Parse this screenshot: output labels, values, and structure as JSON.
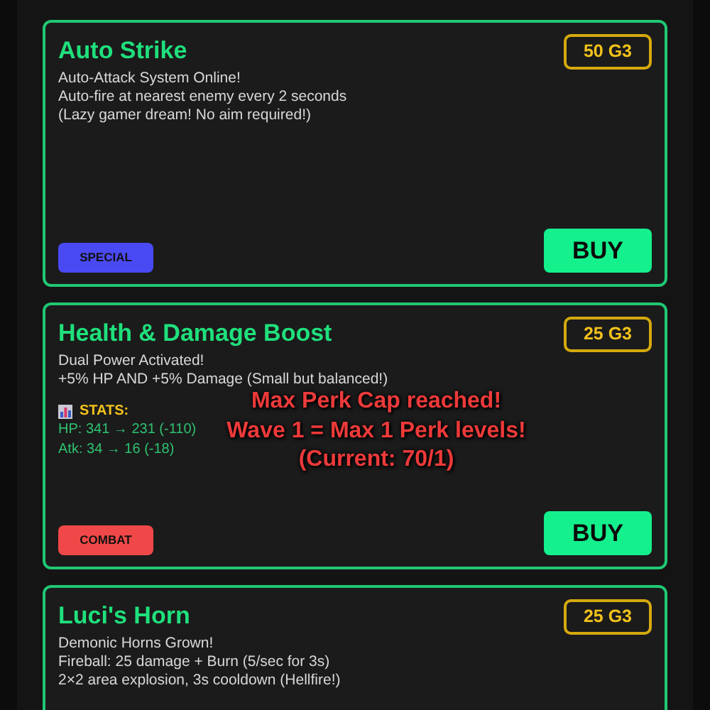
{
  "cards": [
    {
      "title": "Auto Strike",
      "price": "50 G3",
      "description": [
        "Auto-Attack System Online!",
        "Auto-fire at nearest enemy every 2 seconds",
        "(Lazy gamer dream! No aim required!)"
      ],
      "tag": {
        "label": "SPECIAL",
        "color": "#4a4af5"
      },
      "button": "BUY"
    },
    {
      "title": "Health & Damage Boost",
      "price": "25 G3",
      "description": [
        "Dual Power Activated!",
        "+5% HP AND +5% Damage (Small but balanced!)"
      ],
      "stats": {
        "label": "STATS:",
        "lines": [
          "HP: 341 → 231 (-110)",
          "Atk: 34 → 16 (-18)"
        ]
      },
      "tag": {
        "label": "COMBAT",
        "color": "#f04848"
      },
      "button": "BUY",
      "warning": [
        "Max Perk Cap reached!",
        "Wave 1 = Max 1 Perk levels!",
        "(Current: 70/1)"
      ]
    },
    {
      "title": "Luci's Horn",
      "price": "25 G3",
      "description": [
        "Demonic Horns Grown!",
        "Fireball: 25 damage + Burn (5/sec for 3s)",
        "2×2 area explosion, 3s cooldown (Hellfire!)"
      ]
    }
  ]
}
